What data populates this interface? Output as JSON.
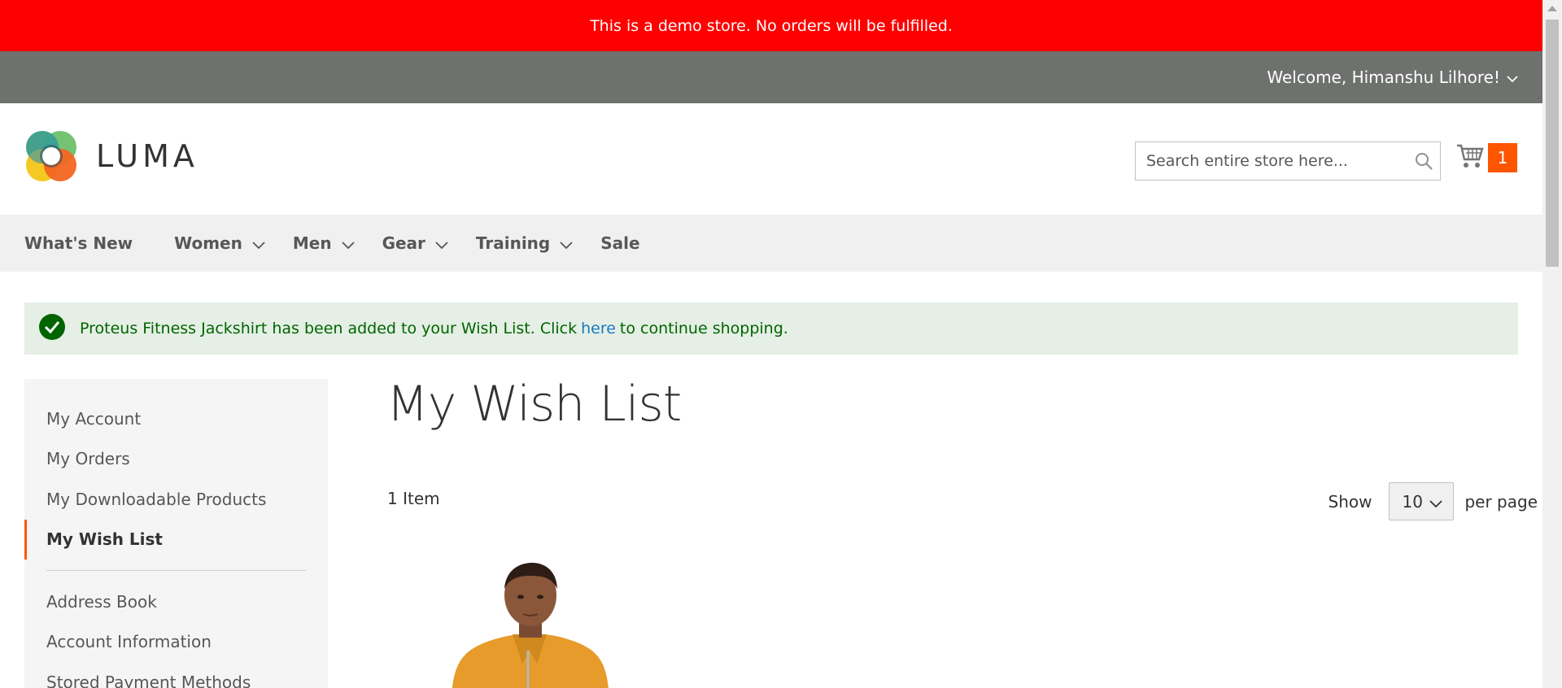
{
  "demo_notice": "This is a demo store. No orders will be fulfilled.",
  "header": {
    "welcome": "Welcome, Himanshu Lilhore!",
    "logo_text": "LUMA",
    "search_placeholder": "Search entire store here...",
    "cart_count": "1"
  },
  "nav": {
    "items": [
      {
        "label": "What's New"
      },
      {
        "label": "Women"
      },
      {
        "label": "Men"
      },
      {
        "label": "Gear"
      },
      {
        "label": "Training"
      },
      {
        "label": "Sale"
      }
    ]
  },
  "message": {
    "text_before": "Proteus Fitness Jackshirt has been added to your Wish List. Click",
    "link": "here",
    "text_after": "to continue shopping."
  },
  "sidebar": {
    "items": [
      {
        "label": "My Account"
      },
      {
        "label": "My Orders"
      },
      {
        "label": "My Downloadable Products"
      },
      {
        "label": "My Wish List"
      },
      {
        "label": "Address Book"
      },
      {
        "label": "Account Information"
      },
      {
        "label": "Stored Payment Methods"
      }
    ]
  },
  "main": {
    "title": "My Wish List",
    "item_count": "1 Item",
    "show_label": "Show",
    "per_page_value": "10",
    "per_page_label": "per page"
  },
  "colors": {
    "demo_banner": "#ff0000",
    "top_bar": "#6e716e",
    "accent": "#ff5501",
    "success_bg": "#e5efe5",
    "link": "#1979c3"
  }
}
